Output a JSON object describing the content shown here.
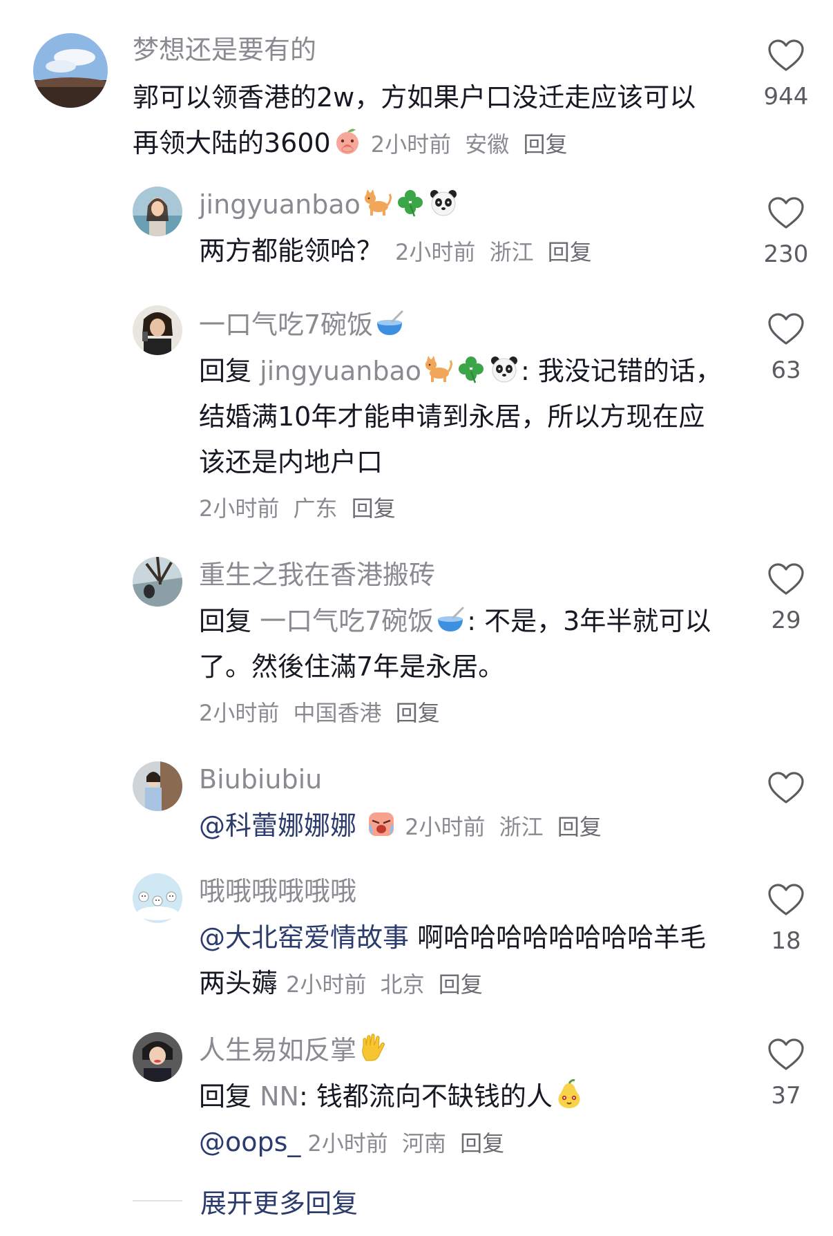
{
  "comments": [
    {
      "username": "梦想还是要有的",
      "text": "郭可以领香港的2w，方如果户口没迁走应该可以再领大陆的3600",
      "time": "2小时前",
      "location": "安徽",
      "reply_label": "回复",
      "likes": "944"
    },
    {
      "username": "jingyuanbao",
      "text": "两方都能领哈？",
      "time": "2小时前",
      "location": "浙江",
      "reply_label": "回复",
      "likes": "230"
    },
    {
      "username": "一口气吃7碗饭",
      "reply_prefix": "回复",
      "reply_to": "jingyuanbao",
      "text": ": 我没记错的话，结婚满10年才能申请到永居，所以方现在应该还是内地户口",
      "time": "2小时前",
      "location": "广东",
      "reply_label": "回复",
      "likes": "63"
    },
    {
      "username": "重生之我在香港搬砖",
      "reply_prefix": "回复",
      "reply_to": "一口气吃7碗饭",
      "text": ": 不是，3年半就可以了。然後住滿7年是永居。",
      "time": "2小时前",
      "location": "中国香港",
      "reply_label": "回复",
      "likes": "29"
    },
    {
      "username": "Biubiubiu",
      "mention": "@科蕾娜娜娜",
      "time": "2小时前",
      "location": "浙江",
      "reply_label": "回复",
      "likes": ""
    },
    {
      "username": "哦哦哦哦哦哦",
      "mention": "@大北窑爱情故事",
      "text": " 啊哈哈哈哈哈哈哈哈羊毛两头薅",
      "time": "2小时前",
      "location": "北京",
      "reply_label": "回复",
      "likes": "18"
    },
    {
      "username": "人生易如反掌",
      "reply_prefix": "回复",
      "reply_to": "NN",
      "text": ": 钱都流向不缺钱的人",
      "mention": "@oops_",
      "time": "2小时前",
      "location": "河南",
      "reply_label": "回复",
      "likes": "37"
    }
  ],
  "expand_label": "展开更多回复",
  "colors": {
    "muted": "#8a8b91",
    "text": "#161823",
    "mention": "#2b3b6e"
  }
}
